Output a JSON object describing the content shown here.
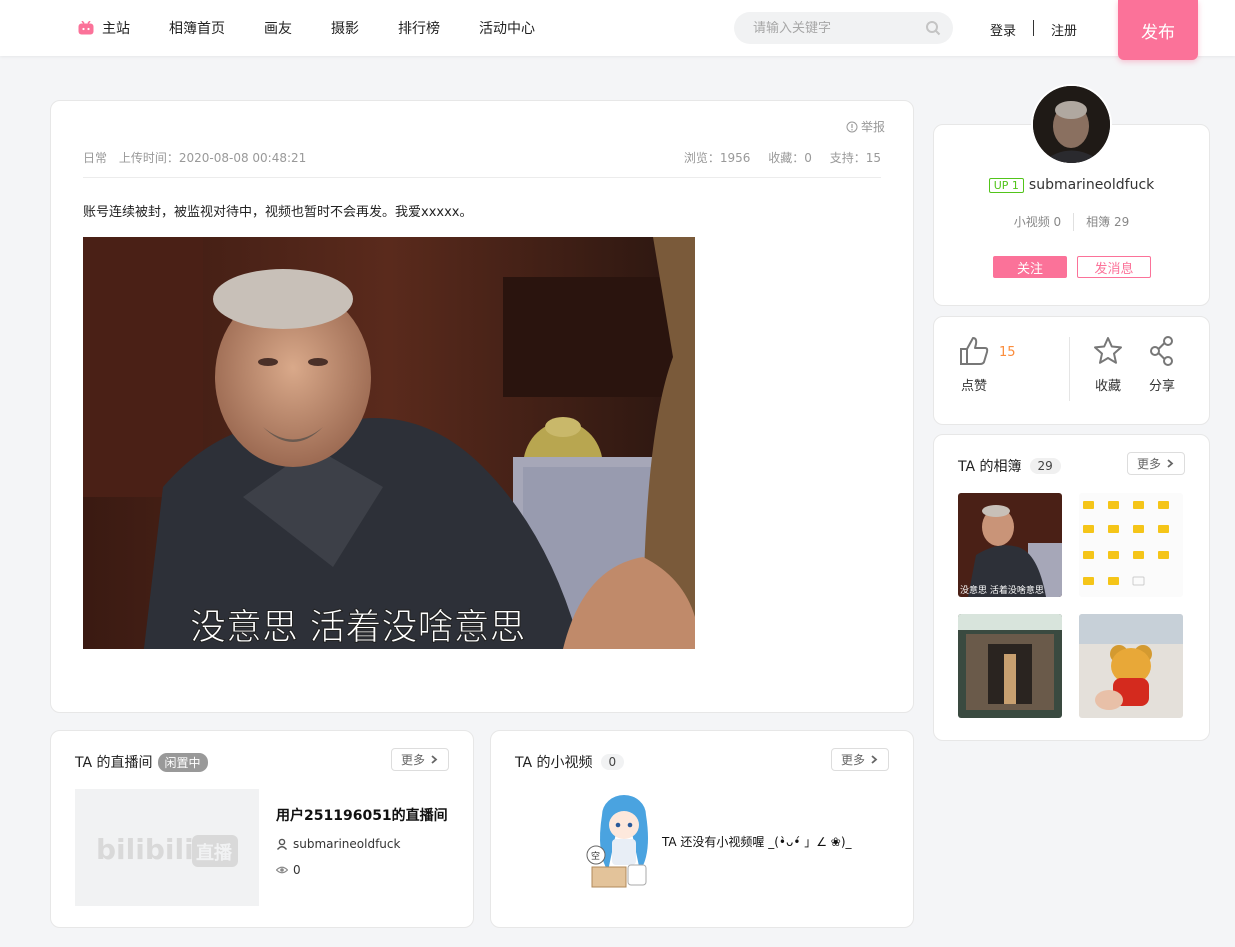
{
  "header": {
    "nav": [
      {
        "label": "主站",
        "icon": "tv-icon"
      },
      {
        "label": "相簿首页"
      },
      {
        "label": "画友"
      },
      {
        "label": "摄影"
      },
      {
        "label": "排行榜"
      },
      {
        "label": "活动中心"
      }
    ],
    "search_placeholder": "请输入关键字",
    "login": "登录",
    "register": "注册",
    "publish": "发布"
  },
  "post": {
    "report": "举报",
    "category": "日常",
    "upload_time": "上传时间：2020-08-08 00:48:21",
    "views": "浏览：1956",
    "favorites": "收藏：0",
    "supports": "支持：15",
    "text": "账号连续被封，被监视对待中，视频也暂时不会再发。我爱xxxxx。",
    "image_caption": "没意思  活着没啥意思"
  },
  "live": {
    "title": "TA 的直播间",
    "status": "闲置中",
    "more": "更多",
    "room_name": "用户251196051的直播间",
    "user": "submarineoldfuck",
    "viewers": "0",
    "thumb_logo": "bilibili",
    "thumb_logo_sub": "直播"
  },
  "videos": {
    "title": "TA 的小视频",
    "count": "0",
    "more": "更多",
    "empty_text": "TA 还没有小视频喔 _(•̀ᴗ•́ 」∠ ❀)_",
    "empty_bubble": "空"
  },
  "profile": {
    "level": "UP 1",
    "username": "submarineoldfuck",
    "small_videos": "小视频 0",
    "albums": "相簿 29",
    "follow": "关注",
    "message": "发消息"
  },
  "actions": {
    "like_count": "15",
    "like": "点赞",
    "favorite": "收藏",
    "share": "分享"
  },
  "albums": {
    "title": "TA 的相簿",
    "count": "29",
    "more": "更多",
    "thumb1_caption": "没意思  活着没啥意思"
  },
  "colors": {
    "accent": "#fb7299",
    "like_count": "#fb8d3c",
    "level": "#52c41a"
  }
}
